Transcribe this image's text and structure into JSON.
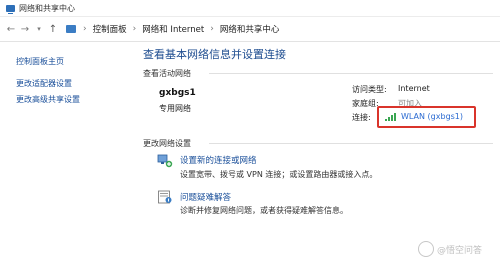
{
  "window": {
    "title": "网络和共享中心"
  },
  "address": {
    "crumbs": [
      "控制面板",
      "网络和 Internet",
      "网络和共享中心"
    ]
  },
  "sidebar": {
    "links": [
      "控制面板主页",
      "更改适配器设置",
      "更改高级共享设置"
    ]
  },
  "main": {
    "heading": "查看基本网络信息并设置连接",
    "active_networks_label": "查看活动网络",
    "network": {
      "name": "gxbgs1",
      "type": "专用网络",
      "access_type_key": "访问类型:",
      "access_type_value": "Internet",
      "homegroup_key": "家庭组:",
      "homegroup_value": "可加入",
      "connection_key": "连接:",
      "connection_value": "WLAN (gxbgs1)"
    },
    "change_settings_label": "更改网络设置",
    "tasks": [
      {
        "link": "设置新的连接或网络",
        "desc": "设置宽带、拨号或 VPN 连接；或设置路由器或接入点。"
      },
      {
        "link": "问题疑难解答",
        "desc": "诊断并修复网络问题，或者获得疑难解答信息。"
      }
    ]
  },
  "watermark": {
    "text": "@悟空问答"
  },
  "colors": {
    "link": "#1a4f9a",
    "heading": "#1c4b8f",
    "highlight_box": "#d9342b",
    "wifi_signal": "#3aa652"
  },
  "icons": [
    "network-center-icon",
    "back-arrow-icon",
    "forward-arrow-icon",
    "up-arrow-icon",
    "control-panel-icon",
    "wifi-signal-icon",
    "new-connection-icon",
    "troubleshoot-icon"
  ]
}
